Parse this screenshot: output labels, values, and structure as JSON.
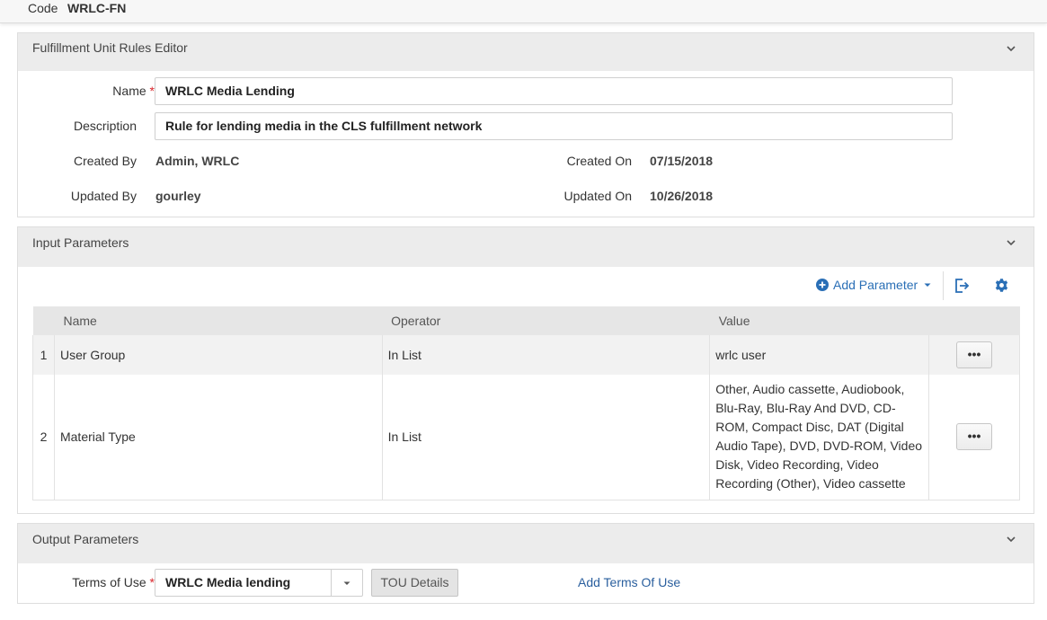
{
  "header": {
    "code_label": "Code",
    "code_value": "WRLC-FN"
  },
  "editor": {
    "title": "Fulfillment Unit Rules Editor",
    "name_label": "Name",
    "required_mark": "*",
    "name_value": "WRLC Media Lending",
    "description_label": "Description",
    "description_value": "Rule for lending media in the CLS fulfillment network",
    "created_by_label": "Created By",
    "created_by_value": "Admin, WRLC",
    "created_on_label": "Created On",
    "created_on_value": "07/15/2018",
    "updated_by_label": "Updated By",
    "updated_by_value": "gourley",
    "updated_on_label": "Updated On",
    "updated_on_value": "10/26/2018"
  },
  "input_params": {
    "title": "Input Parameters",
    "add_parameter_label": "Add Parameter",
    "columns": [
      "Name",
      "Operator",
      "Value"
    ],
    "rows": [
      {
        "index": "1",
        "name": "User Group",
        "operator": "In List",
        "value": "wrlc user",
        "action": "•••"
      },
      {
        "index": "2",
        "name": "Material Type",
        "operator": "In List",
        "value": "Other, Audio cassette, Audiobook, Blu-Ray, Blu-Ray And DVD, CD-ROM, Compact Disc, DAT (Digital Audio Tape), DVD, DVD-ROM, Video Disk, Video Recording, Video Recording (Other), Video cassette",
        "action": "•••"
      }
    ]
  },
  "output_params": {
    "title": "Output Parameters",
    "terms_label": "Terms of Use",
    "required_mark": "*",
    "terms_value": "WRLC Media lending",
    "tou_details_label": "TOU Details",
    "add_terms_label": "Add Terms Of Use"
  },
  "colors": {
    "link": "#2a6fb6",
    "required": "#d9262c",
    "header_bg": "#ececec"
  },
  "icons": [
    "chevron-down-icon",
    "plus-circle-icon",
    "caret-down-icon",
    "export-icon",
    "gear-icon"
  ]
}
